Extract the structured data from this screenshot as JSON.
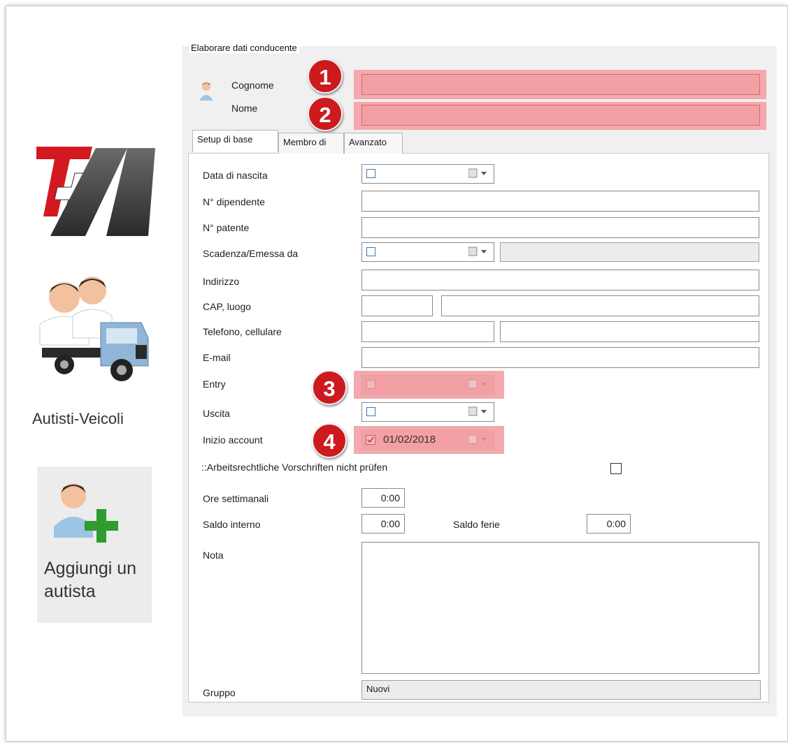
{
  "rail": {
    "drivers_vehicles_label": "Autisti-Veicoli",
    "add_driver_label": "Aggiungi un autista"
  },
  "form": {
    "group_title": "Elaborare dati conducente",
    "surname_label": "Cognome",
    "name_label": "Nome",
    "tabs": [
      {
        "label": "Setup di base"
      },
      {
        "label": "Membro di"
      },
      {
        "label": "Avanzato"
      }
    ],
    "fields": {
      "birth_date": "Data di nascita",
      "employee_no": "N° dipendente",
      "license_no": "N° patente",
      "expiry_issued": "Scadenza/Emessa da",
      "address": "Indirizzo",
      "zip_city": "CAP, luogo",
      "phone_mobile": "Telefono, cellulare",
      "email": "E-mail",
      "entry": "Entry",
      "exit": "Uscita",
      "account_start": "Inizio account",
      "labor_rules": "::Arbeitsrechtliche Vorschriften nicht prüfen",
      "weekly_hours": "Ore settimanali",
      "internal_balance": "Saldo interno",
      "holiday_balance": "Saldo ferie",
      "note": "Nota",
      "group": "Gruppo"
    },
    "values": {
      "account_start_date": "01/02/2018",
      "weekly_hours": "0:00",
      "internal_balance": "0:00",
      "holiday_balance": "0:00",
      "group": "Nuovi"
    }
  },
  "badges": [
    "1",
    "2",
    "3",
    "4"
  ],
  "colors": {
    "highlight": "#f3a9ad",
    "badge": "#cc1a1e",
    "panel": "#f0f0f0"
  }
}
